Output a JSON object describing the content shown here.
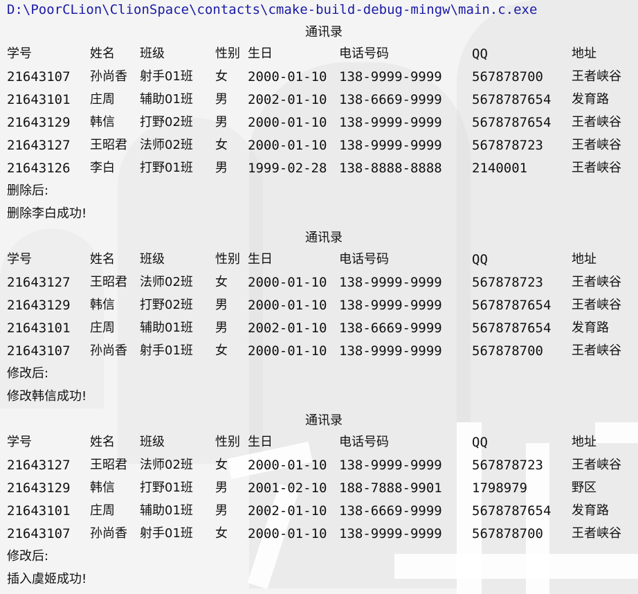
{
  "window": {
    "path": "D:\\PoorCLion\\ClionSpace\\contacts\\cmake-build-debug-mingw\\main.c.exe"
  },
  "headers": {
    "id": "学号",
    "name": "姓名",
    "class": "班级",
    "sex": "性别",
    "birthday": "生日",
    "phone": "电话号码",
    "qq": "QQ",
    "address": "地址"
  },
  "blocks": [
    {
      "title": "通讯录",
      "rows": [
        {
          "id": "21643107",
          "name": "孙尚香",
          "class": "射手01班",
          "sex": "女",
          "birthday": "2000-01-10",
          "phone": "138-9999-9999",
          "qq": "567878700",
          "address": "王者峡谷"
        },
        {
          "id": "21643101",
          "name": "庄周",
          "class": "辅助01班",
          "sex": "男",
          "birthday": "2002-01-10",
          "phone": "138-6669-9999",
          "qq": "5678787654",
          "address": "发育路"
        },
        {
          "id": "21643129",
          "name": "韩信",
          "class": "打野02班",
          "sex": "男",
          "birthday": "2000-01-10",
          "phone": "138-9999-9999",
          "qq": "5678787654",
          "address": "王者峡谷"
        },
        {
          "id": "21643127",
          "name": "王昭君",
          "class": "法师02班",
          "sex": "女",
          "birthday": "2000-01-10",
          "phone": "138-9999-9999",
          "qq": "567878723",
          "address": "王者峡谷"
        },
        {
          "id": "21643126",
          "name": "李白",
          "class": "打野01班",
          "sex": "男",
          "birthday": "1999-02-28",
          "phone": "138-8888-8888",
          "qq": "2140001",
          "address": "王者峡谷"
        }
      ],
      "messages": [
        "删除后:",
        "删除李白成功!"
      ]
    },
    {
      "title": "通讯录",
      "rows": [
        {
          "id": "21643127",
          "name": "王昭君",
          "class": "法师02班",
          "sex": "女",
          "birthday": "2000-01-10",
          "phone": "138-9999-9999",
          "qq": "567878723",
          "address": "王者峡谷"
        },
        {
          "id": "21643129",
          "name": "韩信",
          "class": "打野02班",
          "sex": "男",
          "birthday": "2000-01-10",
          "phone": "138-9999-9999",
          "qq": "5678787654",
          "address": "王者峡谷"
        },
        {
          "id": "21643101",
          "name": "庄周",
          "class": "辅助01班",
          "sex": "男",
          "birthday": "2002-01-10",
          "phone": "138-6669-9999",
          "qq": "5678787654",
          "address": "发育路"
        },
        {
          "id": "21643107",
          "name": "孙尚香",
          "class": "射手01班",
          "sex": "女",
          "birthday": "2000-01-10",
          "phone": "138-9999-9999",
          "qq": "567878700",
          "address": "王者峡谷"
        }
      ],
      "messages": [
        "修改后:",
        "修改韩信成功!"
      ]
    },
    {
      "title": "通讯录",
      "rows": [
        {
          "id": "21643127",
          "name": "王昭君",
          "class": "法师02班",
          "sex": "女",
          "birthday": "2000-01-10",
          "phone": "138-9999-9999",
          "qq": "567878723",
          "address": "王者峡谷"
        },
        {
          "id": "21643129",
          "name": "韩信",
          "class": "打野01班",
          "sex": "男",
          "birthday": "2001-02-10",
          "phone": "188-7888-9901",
          "qq": "1798979",
          "address": "野区"
        },
        {
          "id": "21643101",
          "name": "庄周",
          "class": "辅助01班",
          "sex": "男",
          "birthday": "2002-01-10",
          "phone": "138-6669-9999",
          "qq": "5678787654",
          "address": "发育路"
        },
        {
          "id": "21643107",
          "name": "孙尚香",
          "class": "射手01班",
          "sex": "女",
          "birthday": "2000-01-10",
          "phone": "138-9999-9999",
          "qq": "567878700",
          "address": "王者峡谷"
        }
      ],
      "messages": [
        "修改后:",
        "插入虞姬成功!"
      ]
    }
  ],
  "colors": {
    "path_text": "#1a1aa6",
    "text": "#111111",
    "background": "#f4f4f4"
  }
}
